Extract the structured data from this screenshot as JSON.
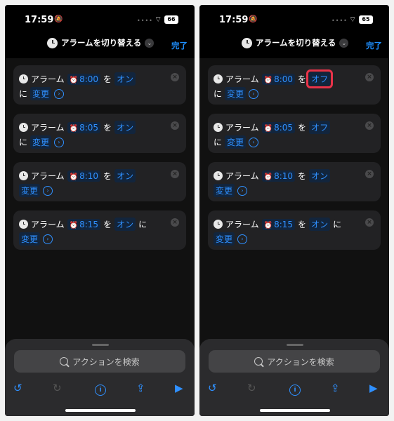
{
  "left": {
    "status": {
      "time": "17:59",
      "battery": "66"
    },
    "header": {
      "title": "アラームを切り替える",
      "done_label": "完了"
    },
    "cards": [
      {
        "a": "アラーム",
        "time": "8:00",
        "wo": "を",
        "state": "オン",
        "ni": "に",
        "change": "変更"
      },
      {
        "a": "アラーム",
        "time": "8:05",
        "wo": "を",
        "state": "オン",
        "ni": "に",
        "change": "変更"
      },
      {
        "a": "アラーム",
        "time": "8:10",
        "wo": "を",
        "state": "オン",
        "ni": "に",
        "change": "変更"
      },
      {
        "a": "アラーム",
        "time": "8:15",
        "wo": "を",
        "state": "オン",
        "ni": "に",
        "change": "変更"
      }
    ],
    "search_placeholder": "アクションを検索"
  },
  "right": {
    "status": {
      "time": "17:59",
      "battery": "65"
    },
    "header": {
      "title": "アラームを切り替える",
      "done_label": "完了"
    },
    "cards": [
      {
        "a": "アラーム",
        "time": "8:00",
        "wo": "を",
        "state": "オフ",
        "ni": "に",
        "change": "変更"
      },
      {
        "a": "アラーム",
        "time": "8:05",
        "wo": "を",
        "state": "オフ",
        "ni": "に",
        "change": "変更"
      },
      {
        "a": "アラーム",
        "time": "8:10",
        "wo": "を",
        "state": "オン",
        "ni": "に",
        "change": "変更"
      },
      {
        "a": "アラーム",
        "time": "8:15",
        "wo": "を",
        "state": "オン",
        "ni": "に",
        "change": "変更"
      }
    ],
    "search_placeholder": "アクションを検索"
  },
  "colors": {
    "accent": "#2f90ff",
    "highlight": "#e8334a",
    "card_bg": "#222224"
  },
  "icons": [
    "clock-icon",
    "alarm-icon",
    "arrow-circle-icon",
    "close-icon",
    "search-icon",
    "undo-icon",
    "redo-icon",
    "info-icon",
    "share-icon",
    "play-icon",
    "silent-bell-icon",
    "wifi-icon",
    "battery-icon"
  ]
}
